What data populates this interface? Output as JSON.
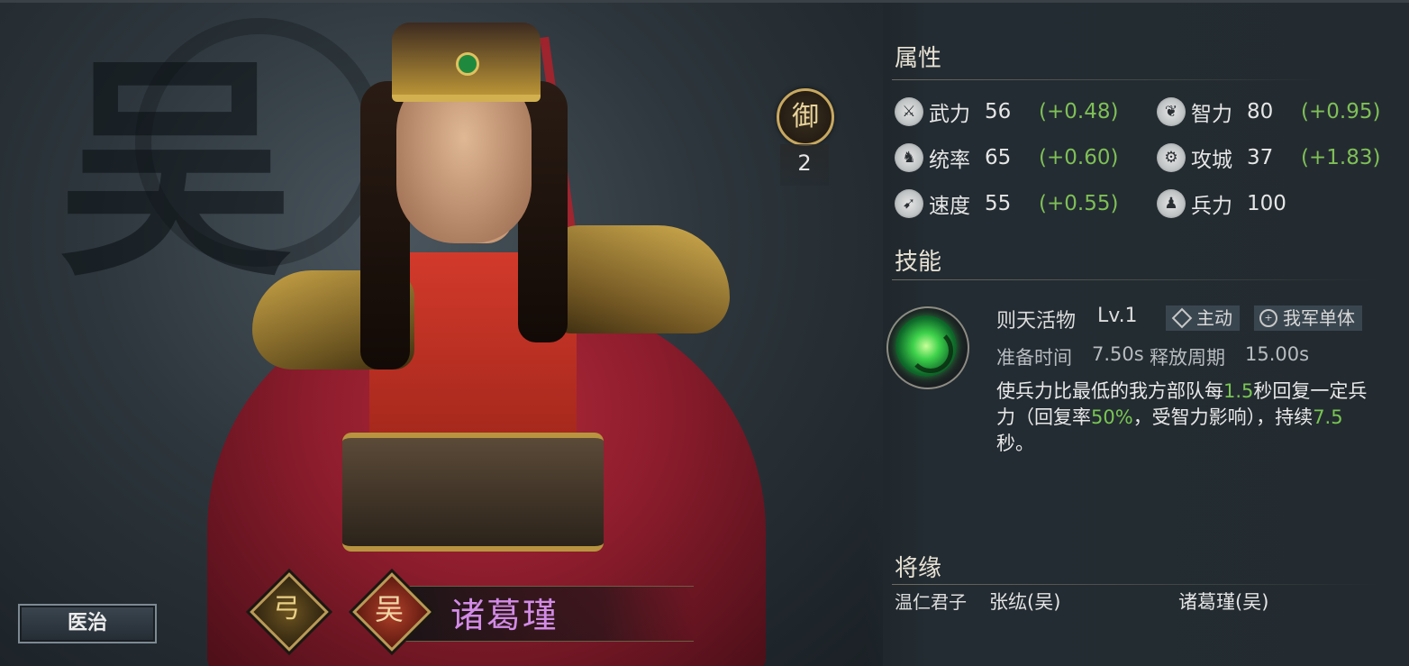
{
  "hero": {
    "name": "诸葛瑾",
    "faction_char": "吴",
    "class_char": "弓",
    "watermark_char": "吴",
    "role_char": "御",
    "role_level": "2"
  },
  "heal_button": "医治",
  "attributes": {
    "title": "属性",
    "stats": [
      {
        "icon": "sword-icon",
        "label": "武力",
        "value": "56",
        "growth": "(+0.48)"
      },
      {
        "icon": "brain-icon",
        "label": "智力",
        "value": "80",
        "growth": "(+0.95)"
      },
      {
        "icon": "banner-icon",
        "label": "统率",
        "value": "65",
        "growth": "(+0.60)"
      },
      {
        "icon": "siege-icon",
        "label": "攻城",
        "value": "37",
        "growth": "(+1.83)"
      },
      {
        "icon": "boot-icon",
        "label": "速度",
        "value": "55",
        "growth": "(+0.55)"
      },
      {
        "icon": "troops-icon",
        "label": "兵力",
        "value": "100",
        "growth": ""
      }
    ]
  },
  "skills": {
    "title": "技能",
    "name": "则天活物",
    "level": "Lv.1",
    "tag_type": "主动",
    "tag_target": "我军单体",
    "prep_label": "准备时间",
    "prep_value": "7.50s",
    "cycle_label": "释放周期",
    "cycle_value": "15.00s",
    "desc_parts": [
      "使兵力比最低的我方部队每",
      "1.5",
      "秒回复一定兵力（回复率",
      "50%",
      "，受智力影响），持续",
      "7.5",
      "秒。"
    ]
  },
  "fate": {
    "title": "将缘",
    "label": "温仁君子",
    "members": [
      "张纮(吴)",
      "诸葛瑾(吴)"
    ]
  },
  "colors": {
    "growth": "#7fbf57",
    "hero_name": "#d28be6",
    "highlight": "#79c653"
  }
}
